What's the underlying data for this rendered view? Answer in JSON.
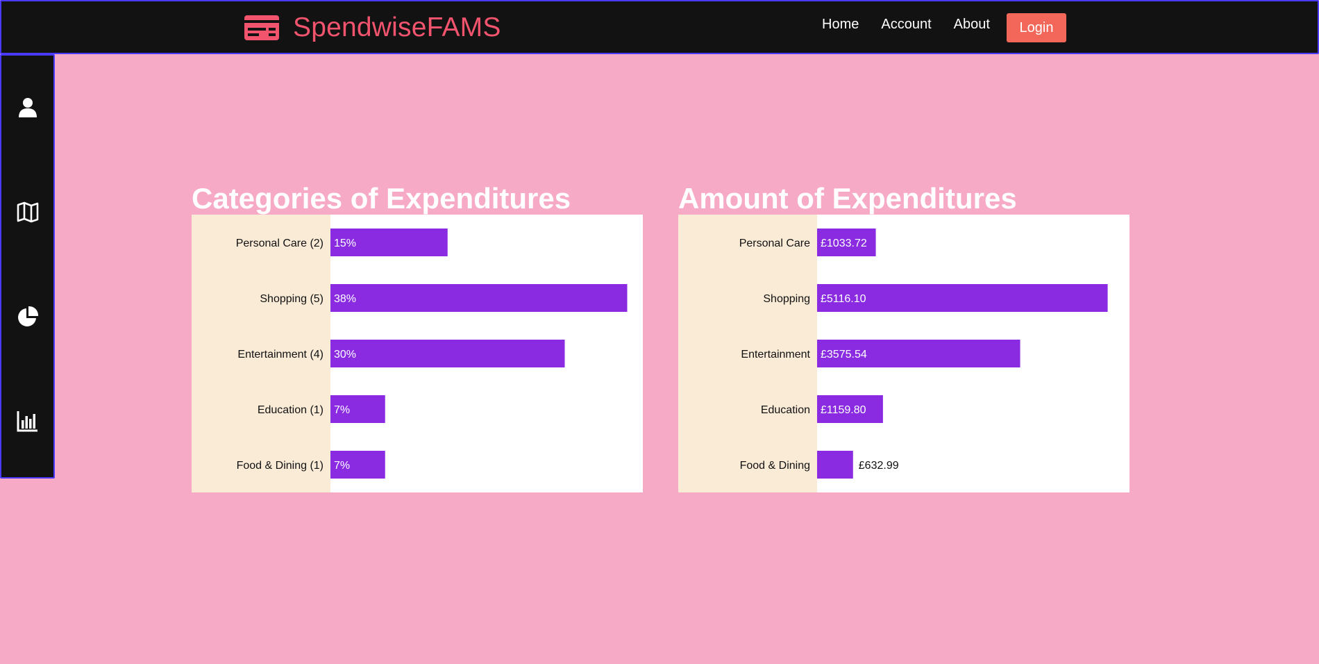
{
  "app": {
    "brand": "SpendwiseFAMS",
    "brand_color": "#f2546e"
  },
  "nav": {
    "links": [
      "Home",
      "Account",
      "About"
    ],
    "login_label": "Login"
  },
  "sidebar": {
    "icons": [
      "user-icon",
      "map-icon",
      "pie-chart-icon",
      "bar-chart-icon"
    ]
  },
  "colors": {
    "background": "#f7aac6",
    "bar": "#8a2be2",
    "label_panel": "#faebd7",
    "accent_border": "#4a3aff"
  },
  "chart_data": [
    {
      "type": "bar",
      "title": "Categories of Expenditures",
      "orientation": "horizontal",
      "categories": [
        "Personal Care (2)",
        "Shopping (5)",
        "Entertainment (4)",
        "Education (1)",
        "Food & Dining (1)"
      ],
      "values": [
        15,
        38,
        30,
        7,
        7
      ],
      "value_labels": [
        "15%",
        "38%",
        "30%",
        "7%",
        "7%"
      ],
      "unit": "%",
      "xlim": [
        0,
        40
      ]
    },
    {
      "type": "bar",
      "title": "Amount of Expenditures",
      "orientation": "horizontal",
      "categories": [
        "Personal Care",
        "Shopping",
        "Entertainment",
        "Education",
        "Food & Dining"
      ],
      "values": [
        1033.72,
        5116.1,
        3575.54,
        1159.8,
        632.99
      ],
      "value_labels": [
        "£1033.72",
        "£5116.10",
        "£3575.54",
        "£1159.80",
        "£632.99"
      ],
      "unit": "£",
      "xlim": [
        0,
        5500
      ]
    }
  ]
}
